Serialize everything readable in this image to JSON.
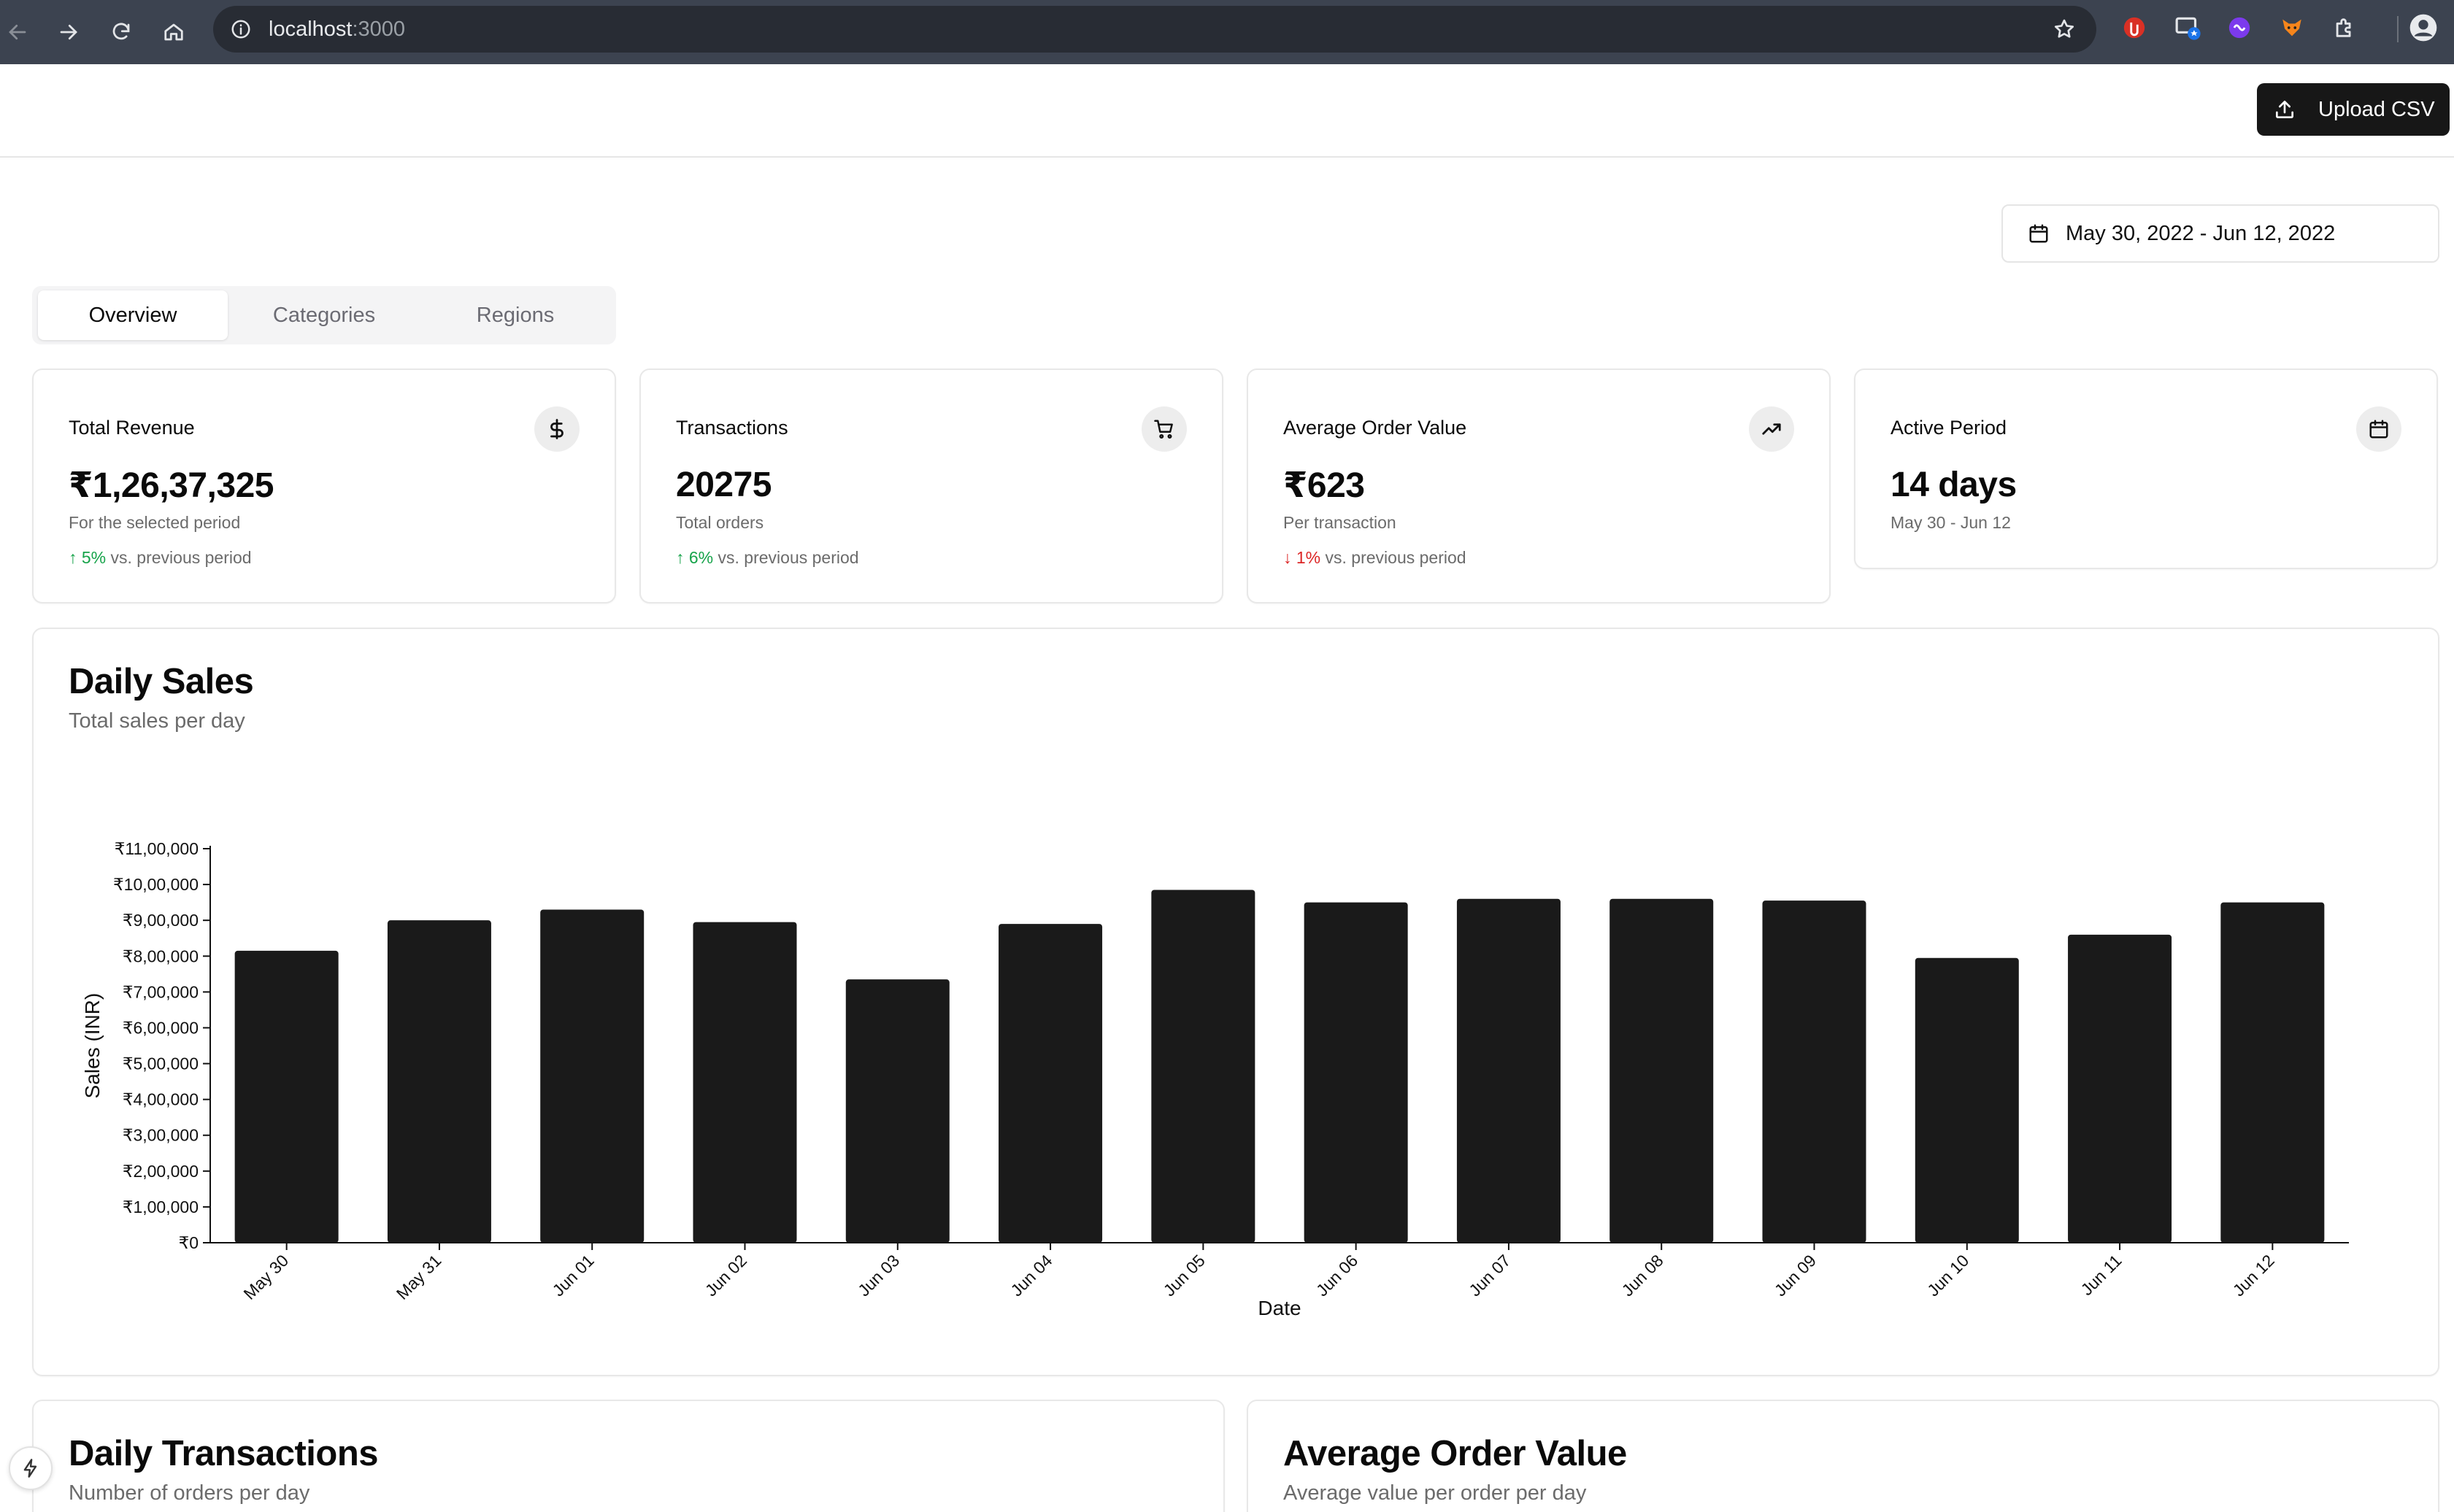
{
  "browser": {
    "url_host": "localhost",
    "url_port": ":3000"
  },
  "header": {
    "upload_label": "Upload CSV"
  },
  "date_range": {
    "label": "May 30, 2022 - Jun 12, 2022"
  },
  "tabs": [
    {
      "label": "Overview",
      "active": true
    },
    {
      "label": "Categories",
      "active": false
    },
    {
      "label": "Regions",
      "active": false
    }
  ],
  "stats": [
    {
      "title": "Total Revenue",
      "value": "₹1,26,37,325",
      "subtitle": "For the selected period",
      "change": "5%",
      "direction": "up",
      "change_suffix": "vs. previous period",
      "icon": "dollar-icon"
    },
    {
      "title": "Transactions",
      "value": "20275",
      "subtitle": "Total orders",
      "change": "6%",
      "direction": "up",
      "change_suffix": "vs. previous period",
      "icon": "cart-icon"
    },
    {
      "title": "Average Order Value",
      "value": "₹623",
      "subtitle": "Per transaction",
      "change": "1%",
      "direction": "down",
      "change_suffix": "vs. previous period",
      "icon": "trending-up-icon"
    },
    {
      "title": "Active Period",
      "value": "14 days",
      "subtitle": "May 30 - Jun 12",
      "icon": "calendar-icon"
    }
  ],
  "daily_sales": {
    "title": "Daily Sales",
    "description": "Total sales per day"
  },
  "chart_data": {
    "type": "bar",
    "categories": [
      "May 30",
      "May 31",
      "Jun 01",
      "Jun 02",
      "Jun 03",
      "Jun 04",
      "Jun 05",
      "Jun 06",
      "Jun 07",
      "Jun 08",
      "Jun 09",
      "Jun 10",
      "Jun 11",
      "Jun 12"
    ],
    "values": [
      815000,
      900000,
      930000,
      895000,
      735000,
      890000,
      985000,
      950000,
      960000,
      960000,
      955000,
      795000,
      860000,
      950000
    ],
    "xlabel": "Date",
    "ylabel": "Sales (INR)",
    "ylim": [
      0,
      1100000
    ],
    "yticks": [
      0,
      100000,
      200000,
      300000,
      400000,
      500000,
      600000,
      700000,
      800000,
      900000,
      1000000,
      1100000
    ],
    "ytick_labels": [
      "₹0",
      "₹1,00,000",
      "₹2,00,000",
      "₹3,00,000",
      "₹4,00,000",
      "₹5,00,000",
      "₹6,00,000",
      "₹7,00,000",
      "₹8,00,000",
      "₹9,00,000",
      "₹10,00,000",
      "₹11,00,000"
    ],
    "bar_color": "#1a1a1a",
    "grid": false
  },
  "daily_transactions": {
    "title": "Daily Transactions",
    "description": "Number of orders per day"
  },
  "avg_order_value": {
    "title": "Average Order Value",
    "description": "Average value per order per day"
  },
  "colors": {
    "chrome": "#3c4350",
    "accent_dark": "#171717",
    "positive": "#16a34a",
    "negative": "#dc2626"
  }
}
